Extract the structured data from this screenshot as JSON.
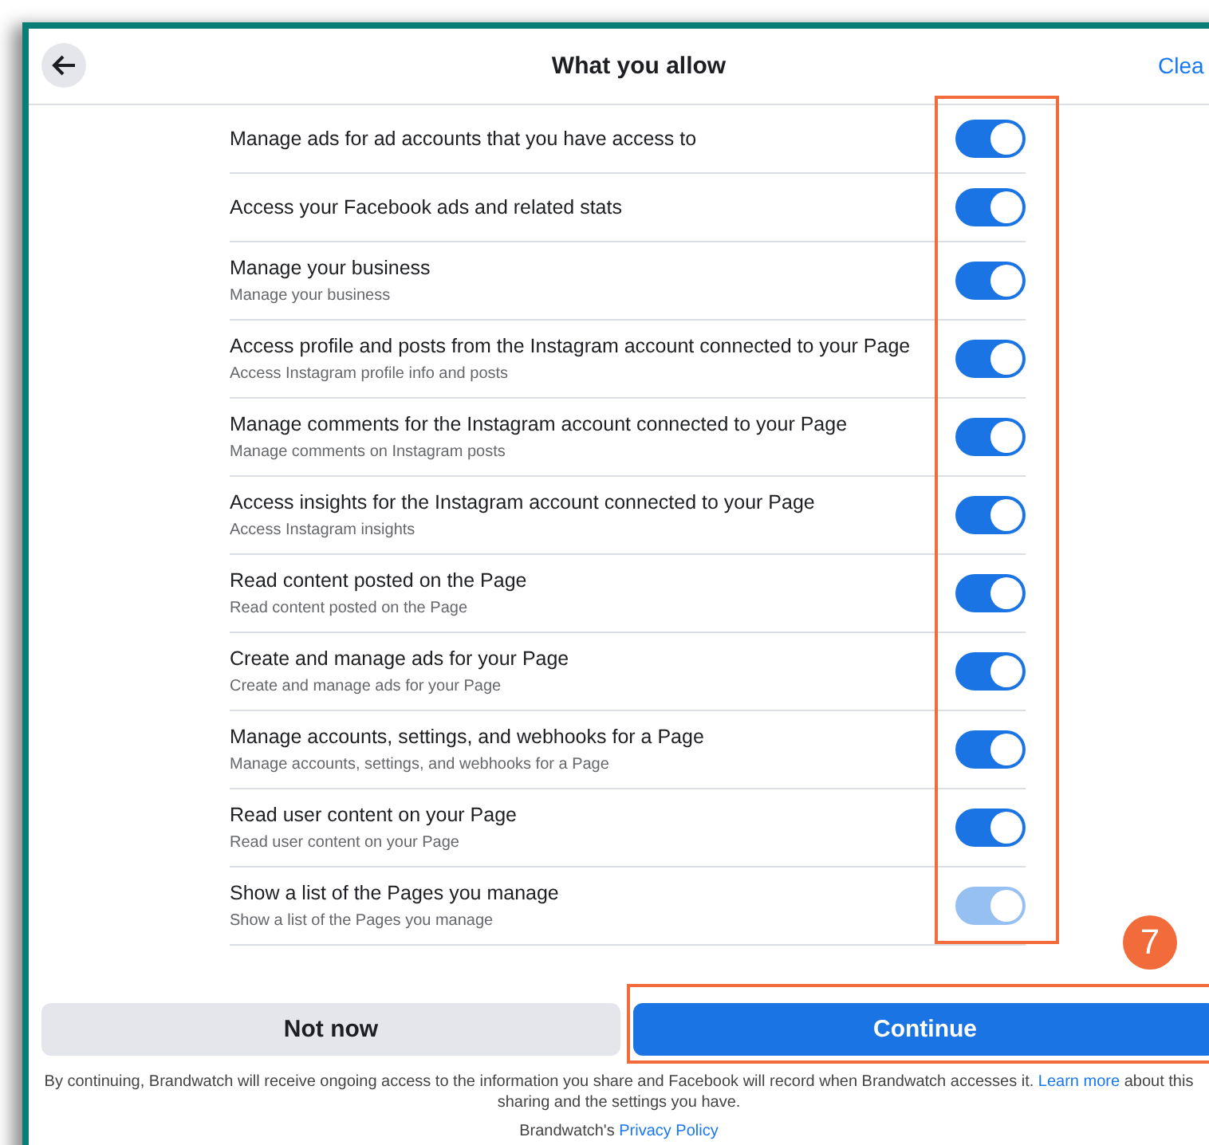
{
  "header": {
    "title": "What you allow",
    "action": "Clea"
  },
  "permissions": [
    {
      "title": "Manage ads for ad accounts that you have access to",
      "on": true,
      "disabled": false
    },
    {
      "title": "Access your Facebook ads and related stats",
      "on": true,
      "disabled": false
    },
    {
      "title": "Manage your business",
      "subtitle": "Manage your business",
      "on": true,
      "disabled": false
    },
    {
      "title": "Access profile and posts from the Instagram account connected to your Page",
      "subtitle": "Access Instagram profile info and posts",
      "on": true,
      "disabled": false
    },
    {
      "title": "Manage comments for the Instagram account connected to your Page",
      "subtitle": "Manage comments on Instagram posts",
      "on": true,
      "disabled": false
    },
    {
      "title": "Access insights for the Instagram account connected to your Page",
      "subtitle": "Access Instagram insights",
      "on": true,
      "disabled": false
    },
    {
      "title": "Read content posted on the Page",
      "subtitle": "Read content posted on the Page",
      "on": true,
      "disabled": false
    },
    {
      "title": "Create and manage ads for your Page",
      "subtitle": "Create and manage ads for your Page",
      "on": true,
      "disabled": false
    },
    {
      "title": "Manage accounts, settings, and webhooks for a Page",
      "subtitle": "Manage accounts, settings, and webhooks for a Page",
      "on": true,
      "disabled": false
    },
    {
      "title": "Read user content on your Page",
      "subtitle": "Read user content on your Page",
      "on": true,
      "disabled": false
    },
    {
      "title": "Show a list of the Pages you manage",
      "subtitle": "Show a list of the Pages you manage",
      "on": true,
      "disabled": true
    }
  ],
  "annotation": {
    "badge": "7"
  },
  "buttons": {
    "secondary": "Not now",
    "primary": "Continue"
  },
  "disclaimer": {
    "text": "By continuing, Brandwatch will receive ongoing access to the information you share and Facebook will record when Brandwatch accesses it.",
    "link": "Learn more",
    "after": "about this sharing and the settings you have."
  },
  "policy": {
    "prefix": "Brandwatch's",
    "link": "Privacy Policy"
  }
}
